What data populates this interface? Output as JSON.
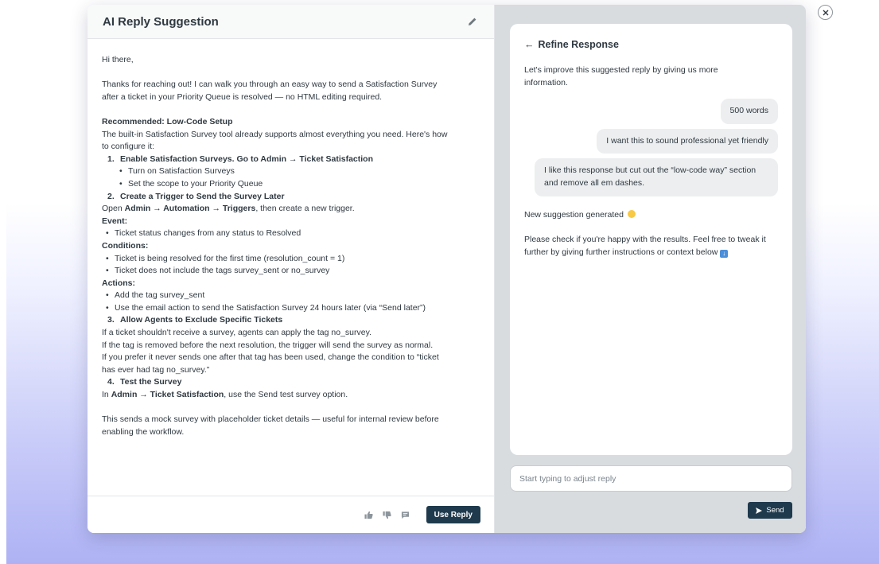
{
  "left": {
    "title": "AI Reply Suggestion",
    "greeting": "Hi there,",
    "intro_1": "Thanks for reaching out! I can walk you through an easy way to send a Satisfaction Survey",
    "intro_2": "after a ticket in your Priority Queue is resolved — no HTML editing required.",
    "rec_heading": "Recommended: Low-Code Setup",
    "rec_1": "The built-in Satisfaction Survey tool already supports almost everything you need. Here's how",
    "rec_2": "to configure it:",
    "step1": {
      "num": "1.",
      "text": "Enable Satisfaction Surveys. Go to Admin → Ticket Satisfaction"
    },
    "step1_b1": "Turn on Satisfaction Surveys",
    "step1_b2": "Set the scope to your Priority Queue",
    "step2": {
      "num": "2.",
      "text": "Create a Trigger to Send the Survey Later"
    },
    "step2_open": "Open ",
    "step2_path": "Admin → Automation → Triggers",
    "step2_rest": ", then create a new trigger.",
    "event_label": "Event:",
    "event_b1": "Ticket status changes from any status to Resolved",
    "cond_label": "Conditions:",
    "cond_b1": "Ticket is being resolved for the first time (resolution_count = 1)",
    "cond_b2": "Ticket does not include the tags survey_sent or no_survey",
    "actions_label": "Actions:",
    "act_b1": "Add the tag survey_sent",
    "act_b2": "Use the email action to send the Satisfaction Survey 24 hours later (via “Send later”)",
    "step3": {
      "num": "3.",
      "text": "Allow Agents to Exclude Specific Tickets"
    },
    "s3_1": "If a ticket shouldn't receive a survey, agents can apply the tag no_survey.",
    "s3_2": "If the tag is removed before the next resolution, the trigger will send the survey as normal.",
    "s3_3": "If you prefer it never sends one after that tag has been used, change the condition to “ticket",
    "s3_4": "has ever had tag no_survey.”",
    "step4": {
      "num": "4.",
      "text": "Test the Survey"
    },
    "s4_in": "In ",
    "s4_path": "Admin → Ticket Satisfaction",
    "s4_rest": ", use the Send test survey option.",
    "outro_1": "This sends a mock survey with placeholder ticket details — useful for internal review before",
    "outro_2": "enabling the workflow.",
    "bullet": "•",
    "use_reply_label": "Use Reply"
  },
  "right": {
    "refine_arrow": "←",
    "refine_title": "Refine Response",
    "intro": "Let's improve this suggested reply by giving us more information.",
    "bubbles": [
      "500 words",
      "I want this to sound professional yet friendly",
      "I like this response but cut out the “low-code way” section and remove all em dashes."
    ],
    "generated": "New suggestion generated",
    "check": "Please check if you're happy with the results. Feel free to tweak it further by giving further instructions or context below",
    "input_placeholder": "Start typing to adjust reply",
    "send_label": "Send"
  },
  "colors": {
    "button_dark": "#1f3a4d",
    "right_panel_bg": "#d8dcdf",
    "bubble_bg": "#eceeef",
    "text": "#2f3941"
  },
  "icons": {
    "edit": "pencil-icon",
    "thumbs_up": "thumbs-up-icon",
    "thumbs_down": "thumbs-down-icon",
    "comment": "comment-icon",
    "send": "send-arrow-icon",
    "close": "close-icon",
    "back": "arrow-left-icon"
  }
}
